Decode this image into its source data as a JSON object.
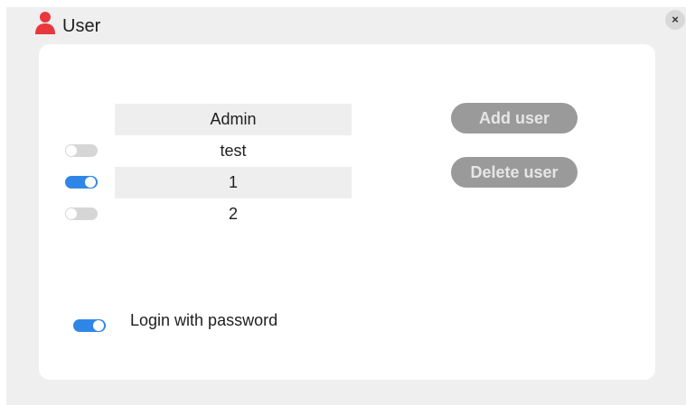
{
  "window": {
    "title": "User",
    "title_icon": "user-icon",
    "close_label": "×"
  },
  "users": {
    "header": "Admin",
    "rows": [
      {
        "name": "test",
        "enabled": false
      },
      {
        "name": "1",
        "enabled": true
      },
      {
        "name": "2",
        "enabled": false
      }
    ]
  },
  "actions": {
    "add_label": "Add user",
    "delete_label": "Delete user"
  },
  "login": {
    "label": "Login with password",
    "enabled": true
  },
  "colors": {
    "accent": "#2f86e6",
    "icon": "#e8383d",
    "button": "#9a9a9a"
  }
}
